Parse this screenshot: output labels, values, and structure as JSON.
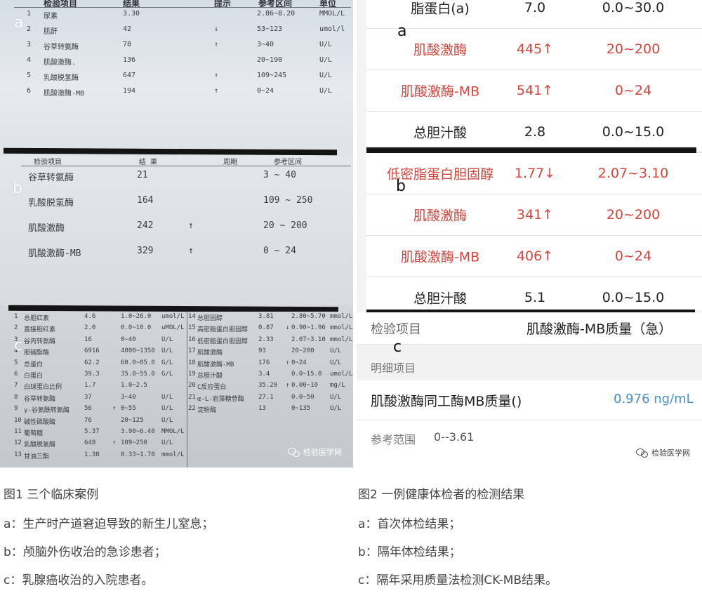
{
  "fig1": {
    "panel_a": {
      "letter": "a",
      "headers": [
        "检验项目",
        "结果",
        "提示",
        "参考区间",
        "单位"
      ],
      "rows": [
        {
          "no": "1",
          "name": "尿素",
          "result": "3.30",
          "flag": "",
          "ref": "2.86~8.20",
          "unit": "MMOL/L"
        },
        {
          "no": "2",
          "name": "肌酐",
          "result": "42",
          "flag": "↓",
          "ref": "53~123",
          "unit": "umol/l"
        },
        {
          "no": "3",
          "name": "谷草转氨酶",
          "result": "78",
          "flag": "↑",
          "ref": "3~40",
          "unit": "U/L"
        },
        {
          "no": "4",
          "name": "肌酸激酶.",
          "result": "136",
          "flag": "",
          "ref": "20~190",
          "unit": "U/L"
        },
        {
          "no": "5",
          "name": "乳酸脱氢酶",
          "result": "647",
          "flag": "↑",
          "ref": "109~245",
          "unit": "U/L"
        },
        {
          "no": "6",
          "name": "肌酸激酶-MB",
          "result": "194",
          "flag": "↑",
          "ref": "0~24",
          "unit": "U/L"
        }
      ]
    },
    "panel_b": {
      "letter": "b",
      "headers": [
        "检验项目",
        "结 果",
        "周期",
        "参考区间"
      ],
      "rows": [
        {
          "name": "谷草转氨酶",
          "result": "21",
          "flag": "",
          "ref": "3 ~ 40"
        },
        {
          "name": "乳酸脱氢酶",
          "result": "164",
          "flag": "",
          "ref": "109 ~ 250"
        },
        {
          "name": "肌酸激酶",
          "result": "242",
          "flag": "↑",
          "ref": "20 ~ 200"
        },
        {
          "name": "肌酸激酶-MB",
          "result": "329",
          "flag": "↑",
          "ref": "0 ~ 24"
        }
      ]
    },
    "panel_c": {
      "letter": "c",
      "left_rows": [
        {
          "no": "1",
          "name": "总胆红素",
          "result": "4.6",
          "flag": "",
          "ref": "1.0~26.0",
          "unit": "umol/L"
        },
        {
          "no": "2",
          "name": "直接胆红素",
          "result": "2.0",
          "flag": "",
          "ref": "0.0~10.0",
          "unit": "uMOL/L"
        },
        {
          "no": "3",
          "name": "谷丙转氨酶",
          "result": "16",
          "flag": "",
          "ref": "0~40",
          "unit": "U/L"
        },
        {
          "no": "4",
          "name": "胆碱酯酶",
          "result": "6916",
          "flag": "",
          "ref": "4000~1350",
          "unit": "U/L"
        },
        {
          "no": "5",
          "name": "总蛋白",
          "result": "62.2",
          "flag": "",
          "ref": "60.0~85.0",
          "unit": "G/L"
        },
        {
          "no": "6",
          "name": "白蛋白",
          "result": "39.3",
          "flag": "",
          "ref": "35.0~55.0",
          "unit": "G/L"
        },
        {
          "no": "7",
          "name": "白球蛋白比例",
          "result": "1.7",
          "flag": "",
          "ref": "1.0~2.5",
          "unit": ""
        },
        {
          "no": "8",
          "name": "谷草转氨酶",
          "result": "37",
          "flag": "",
          "ref": "3~40",
          "unit": "U/L"
        },
        {
          "no": "9",
          "name": "γ-谷氨酰转氨酶",
          "result": "56",
          "flag": "↑",
          "ref": "0~55",
          "unit": "U/L"
        },
        {
          "no": "10",
          "name": "碱性磷酸酶",
          "result": "76",
          "flag": "",
          "ref": "20~125",
          "unit": "U/L"
        },
        {
          "no": "11",
          "name": "葡萄糖",
          "result": "5.37",
          "flag": "",
          "ref": "3.90~6.40",
          "unit": "MMOL/L"
        },
        {
          "no": "12",
          "name": "乳酸脱氢酶",
          "result": "648",
          "flag": "↑",
          "ref": "109~250",
          "unit": "U/L"
        },
        {
          "no": "13",
          "name": "甘油三酯",
          "result": "1.38",
          "flag": "",
          "ref": "0.33~1.70",
          "unit": "mmol/L"
        }
      ],
      "right_rows": [
        {
          "no": "14",
          "name": "总胆固醇",
          "result": "3.81",
          "flag": "",
          "ref": "2.80~5.70",
          "unit": "mmol/L"
        },
        {
          "no": "15",
          "name": "高密脂蛋白胆固醇",
          "result": "0.87",
          "flag": "↓",
          "ref": "0.90~1.96",
          "unit": "mmol/L"
        },
        {
          "no": "16",
          "name": "低密脂蛋白胆固醇",
          "result": "2.33",
          "flag": "",
          "ref": "2.07~3.10",
          "unit": "mmol/L"
        },
        {
          "no": "17",
          "name": "肌酸激酶",
          "result": "93",
          "flag": "",
          "ref": "20~200",
          "unit": "U/L"
        },
        {
          "no": "18",
          "name": "肌酸激酶-MB",
          "result": "176",
          "flag": "↑",
          "ref": "0~24",
          "unit": "U/L"
        },
        {
          "no": "19",
          "name": "总胆汁酸",
          "result": "3.4",
          "flag": "",
          "ref": "0.0~15.0",
          "unit": "umol/L"
        },
        {
          "no": "20",
          "name": "C反应蛋白",
          "result": "35.20",
          "flag": "↑",
          "ref": "0.00~10",
          "unit": "mg/L"
        },
        {
          "no": "21",
          "name": "α-L-岩藻糖苷酶",
          "result": "27.1",
          "flag": "",
          "ref": "0.0~50",
          "unit": "U/L"
        },
        {
          "no": "22",
          "name": "淀粉酶",
          "result": "13",
          "flag": "",
          "ref": "0~135",
          "unit": "U/L"
        }
      ]
    },
    "watermark": "检验医学网"
  },
  "fig2": {
    "panel_a": {
      "letter": "a",
      "rows": [
        {
          "name": "脂蛋白(a)",
          "result": "7.0",
          "ref": "0.0~30.0",
          "abnormal": false
        },
        {
          "name": "肌酸激酶",
          "result": "445↑",
          "ref": "20~200",
          "abnormal": true
        },
        {
          "name": "肌酸激酶-MB",
          "result": "541↑",
          "ref": "0~24",
          "abnormal": true
        },
        {
          "name": "总胆汁酸",
          "result": "2.8",
          "ref": "0.0~15.0",
          "abnormal": false
        }
      ]
    },
    "panel_b": {
      "letter": "b",
      "rows": [
        {
          "name": "低密脂蛋白胆固醇",
          "result": "1.77↓",
          "ref": "2.07~3.10",
          "abnormal": true
        },
        {
          "name": "肌酸激酶",
          "result": "341↑",
          "ref": "20~200",
          "abnormal": true
        },
        {
          "name": "肌酸激酶-MB",
          "result": "406↑",
          "ref": "0~24",
          "abnormal": true
        },
        {
          "name": "总胆汁酸",
          "result": "5.1",
          "ref": "0.0~15.0",
          "abnormal": false
        }
      ]
    },
    "panel_c": {
      "letter": "c",
      "item_label": "检验项目",
      "item_value": "肌酸激酶-MB质量（急）",
      "detail_label": "明细项目",
      "detail_name": "肌酸激酶同工酶MB质量()",
      "detail_value": "0.976 ng/mL",
      "ref_label": "参考范围",
      "ref_value": "0--3.61"
    },
    "watermark": "检验医学网"
  },
  "captions": {
    "fig1": {
      "title": "图1 三个临床案例",
      "a": "a：生产时产道窘迫导致的新生儿窒息；",
      "b": "b：颅脑外伤收治的急诊患者；",
      "c": "c：乳腺癌收治的入院患者。"
    },
    "fig2": {
      "title": "图2 一例健康体检者的检测结果",
      "a": "a：首次体检结果；",
      "b": "b：隔年体检结果；",
      "c": "c：隔年采用质量法检测CK-MB结果。"
    }
  },
  "colors": {
    "abnormal_red": "#d6453c",
    "value_blue": "#4a8fc9",
    "bar": "#141414"
  }
}
